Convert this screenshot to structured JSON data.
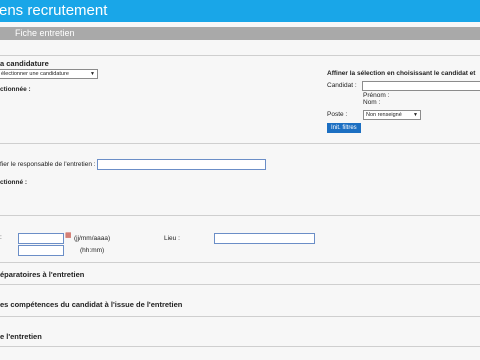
{
  "header": {
    "title": "ens recrutement"
  },
  "section": {
    "title": "Fiche entretien"
  },
  "candidature": {
    "heading": "a candidature",
    "select_value": "électionner une candidature",
    "selected_label": "ctionnée :"
  },
  "filter": {
    "heading": "Affiner la sélection en choisissant le candidat et",
    "candidat_label": "Candidat :",
    "prenom_label": "Prénom :",
    "nom_label": "Nom :",
    "poste_label": "Poste :",
    "poste_value": "Non renseigné",
    "init_button": "Init. filtres"
  },
  "responsable": {
    "label": "fier le responsable de l'entretien :",
    "selected_label": "ctionné :"
  },
  "date": {
    "label": ":",
    "date_format": "(jj/mm/aaaa)",
    "time_format": "(hh:mm)",
    "lieu_label": "Lieu :"
  },
  "sections": {
    "preparatoires": "éparatoires à l'entretien",
    "competences": "es compétences du candidat à l'issue de l'entretien",
    "entretien": "e l'entretien"
  },
  "icons": {
    "calendar": "calendar-icon",
    "dropdown": "chevron-down-icon"
  },
  "colors": {
    "topbar": "#19a6e8",
    "button": "#1c6fc2",
    "section_bar": "#a9a9a9"
  }
}
